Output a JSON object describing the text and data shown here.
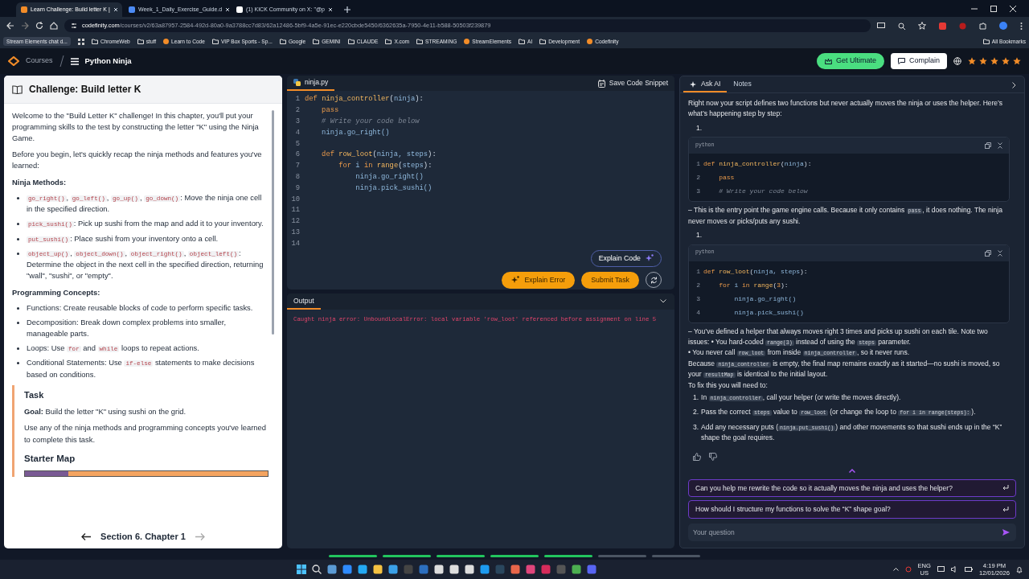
{
  "browser": {
    "tabs": [
      {
        "title": "Learn Challenge: Build letter K |",
        "selected": true,
        "kind": "course"
      },
      {
        "title": "Week_1_Daily_Exercise_Guide.d",
        "selected": false,
        "kind": "doc"
      },
      {
        "title": "(1) KICK Community on X: \"@p",
        "selected": false,
        "kind": "x"
      }
    ],
    "url_host": "codefinity.com",
    "url_path": "/courses/v2/63a87957-2584-492d-80a0-9a3788cc7d83/62a12486-5bf9-4a5e-91ec-e220cbde5450/6362635a-7950-4e11-b588-50503f239879",
    "bookmarks": [
      {
        "label": "Stream Elements chat d...",
        "kind": "chip"
      },
      {
        "label": "ChromeWeb",
        "kind": "folder"
      },
      {
        "label": "stuff",
        "kind": "folder"
      },
      {
        "label": "Learn to Code",
        "kind": "site"
      },
      {
        "label": "VIP Box Sports - Sp...",
        "kind": "folder"
      },
      {
        "label": "Google",
        "kind": "folder"
      },
      {
        "label": "GEMINI",
        "kind": "folder"
      },
      {
        "label": "CLAUDE",
        "kind": "folder"
      },
      {
        "label": "X.com",
        "kind": "folder"
      },
      {
        "label": "STREAMING",
        "kind": "folder"
      },
      {
        "label": "StreamElements",
        "kind": "site"
      },
      {
        "label": "AI",
        "kind": "folder"
      },
      {
        "label": "Development",
        "kind": "folder"
      },
      {
        "label": "Codefinity",
        "kind": "site"
      }
    ],
    "all_bookmarks": "All Bookmarks"
  },
  "header": {
    "courses": "Courses",
    "course": "Python Ninja",
    "get_ultimate": "Get Ultimate",
    "complain": "Complain",
    "stars": 5
  },
  "lesson": {
    "title": "Challenge: Build letter K",
    "blocks": [
      {
        "kind": "paragraph",
        "parts": [
          {
            "text": "Welcome to the \"Build Letter K\" challenge! In this chapter, you'll put your programming skills to the test by constructing the letter \"K\" using the Ninja Game."
          }
        ]
      },
      {
        "kind": "paragraph",
        "parts": [
          {
            "text": "Before you begin, let's quickly recap the ninja methods and features you've learned:"
          }
        ]
      },
      {
        "kind": "heading",
        "text": "Ninja Methods:"
      },
      {
        "kind": "list",
        "items": [
          {
            "parts": [
              {
                "code": "go_right()"
              },
              {
                "text": ", "
              },
              {
                "code": "go_left()"
              },
              {
                "text": ", "
              },
              {
                "code": "go_up()"
              },
              {
                "text": ", "
              },
              {
                "code": "go_down()"
              },
              {
                "text": ": Move the ninja one cell in the specified direction."
              }
            ]
          },
          {
            "parts": [
              {
                "code": "pick_sushi()"
              },
              {
                "text": ": Pick up sushi from the map and add it to your inventory."
              }
            ]
          },
          {
            "parts": [
              {
                "code": "put_sushi()"
              },
              {
                "text": ": Place sushi from your inventory onto a cell."
              }
            ]
          },
          {
            "parts": [
              {
                "code": "object_up()"
              },
              {
                "text": ", "
              },
              {
                "code": "object_down()"
              },
              {
                "text": ", "
              },
              {
                "code": "object_right()"
              },
              {
                "text": ", "
              },
              {
                "code": "object_left()"
              },
              {
                "text": ": Determine the object in the next cell in the specified direction, returning \"wall\", \"sushi\", or \"empty\"."
              }
            ]
          }
        ]
      },
      {
        "kind": "heading",
        "text": "Programming Concepts:"
      },
      {
        "kind": "list",
        "items": [
          {
            "parts": [
              {
                "text": "Functions: Create reusable blocks of code to perform specific tasks."
              }
            ]
          },
          {
            "parts": [
              {
                "text": "Decomposition: Break down complex problems into smaller, manageable parts."
              }
            ]
          },
          {
            "parts": [
              {
                "text": "Loops: Use "
              },
              {
                "code": "for"
              },
              {
                "text": " and "
              },
              {
                "code": "while"
              },
              {
                "text": " loops to repeat actions."
              }
            ]
          },
          {
            "parts": [
              {
                "text": "Conditional Statements: Use "
              },
              {
                "code": "if-else"
              },
              {
                "text": " statements to make decisions based on conditions."
              }
            ]
          }
        ]
      },
      {
        "kind": "task",
        "title": "Task",
        "blocks": [
          {
            "kind": "paragraph",
            "parts": [
              {
                "text": "**Goal:** Build the letter \"K\" using sushi on the grid."
              }
            ]
          },
          {
            "kind": "paragraph",
            "parts": [
              {
                "text": "Use any of the ninja methods and programming concepts you've learned to complete this task."
              }
            ]
          },
          {
            "kind": "subheading",
            "text": "Starter Map"
          },
          {
            "kind": "map"
          }
        ]
      }
    ],
    "footer": "Section 6. Chapter 1",
    "next_disabled": true
  },
  "editor": {
    "file": "ninja.py",
    "save": "Save Code Snippet",
    "lines": [
      {
        "number": "1",
        "tokens": [
          {
            "kind": "kw",
            "text": "def "
          },
          {
            "kind": "fn",
            "text": "ninja_controller"
          },
          {
            "kind": "plain",
            "text": "("
          },
          {
            "kind": "var",
            "text": "ninja"
          },
          {
            "kind": "plain",
            "text": "):"
          }
        ]
      },
      {
        "number": "2",
        "tokens": [
          {
            "kind": "kw",
            "text": "    pass"
          }
        ]
      },
      {
        "number": "3",
        "tokens": [
          {
            "kind": "comment",
            "text": "    # Write your code below"
          }
        ]
      },
      {
        "number": "4",
        "tokens": [
          {
            "kind": "var",
            "text": "    ninja.go_right()"
          }
        ]
      },
      {
        "number": "5"
      },
      {
        "number": "6",
        "tokens": [
          {
            "kind": "kw",
            "text": "    def "
          },
          {
            "kind": "fn",
            "text": "row_loot"
          },
          {
            "kind": "plain",
            "text": "("
          },
          {
            "kind": "var",
            "text": "ninja, steps"
          },
          {
            "kind": "plain",
            "text": "):"
          }
        ]
      },
      {
        "number": "7",
        "tokens": [
          {
            "kind": "kw",
            "text": "        for "
          },
          {
            "kind": "var",
            "text": "i "
          },
          {
            "kind": "kw",
            "text": "in "
          },
          {
            "kind": "fn",
            "text": "range"
          },
          {
            "kind": "plain",
            "text": "("
          },
          {
            "kind": "var",
            "text": "steps"
          },
          {
            "kind": "plain",
            "text": "):"
          }
        ]
      },
      {
        "number": "8",
        "tokens": [
          {
            "kind": "var",
            "text": "            ninja.go_right()"
          }
        ]
      },
      {
        "number": "9",
        "tokens": [
          {
            "kind": "var",
            "text": "            ninja.pick_sushi()"
          }
        ]
      },
      {
        "number": "10"
      },
      {
        "number": "11"
      },
      {
        "number": "12"
      },
      {
        "number": "13"
      },
      {
        "number": "14"
      }
    ],
    "explain_code": "Explain Code",
    "explain_error": "Explain Error",
    "submit": "Submit Task"
  },
  "output": {
    "tab": "Output",
    "error": "Caught ninja error: UnboundLocalError: local variable 'row_loot' referenced before assignment on line 5"
  },
  "progress_steps": [
    {
      "done": true
    },
    {
      "done": true
    },
    {
      "done": true
    },
    {
      "done": true
    },
    {
      "done": true
    },
    {
      "done": false
    },
    {
      "done": false
    }
  ],
  "assistant": {
    "tabs": [
      {
        "label": "Ask AI",
        "selected": true,
        "kind": "ai"
      },
      {
        "label": "Notes",
        "selected": false,
        "kind": "notes"
      }
    ],
    "blocks": [
      {
        "kind": "paragraph",
        "parts": [
          {
            "text": "Right now your script defines two functions but never actually moves the ninja or uses the helper. Here’s what’s happening step by step:"
          }
        ]
      },
      {
        "kind": "marker",
        "text": "1."
      },
      {
        "kind": "code",
        "language": "python",
        "lines": [
          {
            "number": "1",
            "tokens": [
              {
                "kind": "kw",
                "text": "def "
              },
              {
                "kind": "fn",
                "text": "ninja_controller"
              },
              {
                "kind": "plain",
                "text": "("
              },
              {
                "kind": "var",
                "text": "ninja"
              },
              {
                "kind": "plain",
                "text": "):"
              }
            ]
          },
          {
            "number": "2",
            "tokens": [
              {
                "kind": "kw",
                "text": "    pass"
              }
            ]
          },
          {
            "number": "3",
            "tokens": [
              {
                "kind": "comment",
                "text": "    # Write your code below"
              }
            ]
          }
        ]
      },
      {
        "kind": "paragraph",
        "parts": [
          {
            "text": "– This is the entry point the game engine calls. Because it only contains "
          },
          {
            "code": "pass"
          },
          {
            "text": ", it does nothing. The ninja never moves or picks/puts any sushi."
          }
        ]
      },
      {
        "kind": "marker",
        "text": "1."
      },
      {
        "kind": "code",
        "language": "python",
        "lines": [
          {
            "number": "1",
            "tokens": [
              {
                "kind": "kw",
                "text": "def "
              },
              {
                "kind": "fn",
                "text": "row_loot"
              },
              {
                "kind": "plain",
                "text": "("
              },
              {
                "kind": "var",
                "text": "ninja, steps"
              },
              {
                "kind": "plain",
                "text": "):"
              }
            ]
          },
          {
            "number": "2",
            "tokens": [
              {
                "kind": "kw",
                "text": "    for "
              },
              {
                "kind": "var",
                "text": "i "
              },
              {
                "kind": "kw",
                "text": "in "
              },
              {
                "kind": "fn",
                "text": "range"
              },
              {
                "kind": "plain",
                "text": "("
              },
              {
                "kind": "num",
                "text": "3"
              },
              {
                "kind": "plain",
                "text": "):"
              }
            ]
          },
          {
            "number": "3",
            "tokens": [
              {
                "kind": "var",
                "text": "        ninja.go_right()"
              }
            ]
          },
          {
            "number": "4",
            "tokens": [
              {
                "kind": "var",
                "text": "        ninja.pick_sushi()"
              }
            ]
          }
        ]
      },
      {
        "kind": "line",
        "parts": [
          {
            "text": "– You’ve defined a helper that always moves right 3 times and picks up sushi on each tile. Note two issues: • You hard-coded "
          },
          {
            "code": "range(3)"
          },
          {
            "text": " instead of using the "
          },
          {
            "code": "steps"
          },
          {
            "text": " parameter."
          }
        ]
      },
      {
        "kind": "line",
        "parts": [
          {
            "text": "• You never call "
          },
          {
            "code": "row_loot"
          },
          {
            "text": " from inside "
          },
          {
            "code": "ninja_controller"
          },
          {
            "text": ", so it never runs."
          }
        ]
      },
      {
        "kind": "line",
        "parts": [
          {
            "text": "Because "
          },
          {
            "code": "ninja_controller"
          },
          {
            "text": " is empty, the final map remains exactly as it started—no sushi is moved, so your "
          },
          {
            "code": "resultMap"
          },
          {
            "text": " is identical to the initial layout."
          }
        ]
      },
      {
        "kind": "line",
        "parts": [
          {
            "text": "To fix this you will need to:"
          }
        ]
      },
      {
        "kind": "steps",
        "items": [
          {
            "number": "1.",
            "parts": [
              {
                "text": "In "
              },
              {
                "code": "ninja_controller"
              },
              {
                "text": ", call your helper (or write the moves directly)."
              }
            ]
          },
          {
            "number": "2.",
            "parts": [
              {
                "text": "Pass the correct "
              },
              {
                "code": "steps"
              },
              {
                "text": " value to "
              },
              {
                "code": "row_loot"
              },
              {
                "text": " (or change the loop to "
              },
              {
                "code": "for i in range(steps):"
              },
              {
                "text": ")."
              }
            ]
          },
          {
            "number": "3.",
            "parts": [
              {
                "text": "Add any necessary puts ("
              },
              {
                "code": "ninja.put_sushi()"
              },
              {
                "text": ") and other movements so that sushi ends up in the “K” shape the goal requires."
              }
            ]
          }
        ]
      }
    ],
    "suggestions": [
      "Can you help me rewrite the code so it actually moves the ninja and uses the helper?",
      "How should I structure my functions to solve the “K” shape goal?"
    ],
    "placeholder": "Your question"
  },
  "taskbar": {
    "language": "ENG",
    "region": "US",
    "time": "4:19 PM",
    "date": "12/01/2026"
  }
}
